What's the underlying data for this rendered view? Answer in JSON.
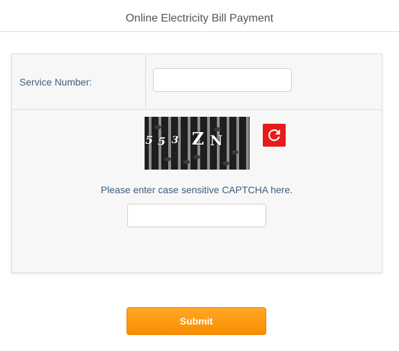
{
  "page": {
    "title": "Online Electricity Bill Payment"
  },
  "form": {
    "service_number": {
      "label": "Service Number:",
      "value": "",
      "placeholder": ""
    },
    "captcha": {
      "image_text": "5 5 3 ZN",
      "characters": [
        "5",
        "5",
        "3",
        "Z",
        "N"
      ],
      "refresh_icon": "refresh-icon",
      "hint": "Please enter case sensitive CAPTCHA here.",
      "value": "",
      "placeholder": ""
    },
    "submit_label": "Submit"
  },
  "colors": {
    "label_text": "#3d5c80",
    "refresh_button": "#e81b1b",
    "submit_button": "#f98d00",
    "panel_background": "#f7f7f7"
  }
}
